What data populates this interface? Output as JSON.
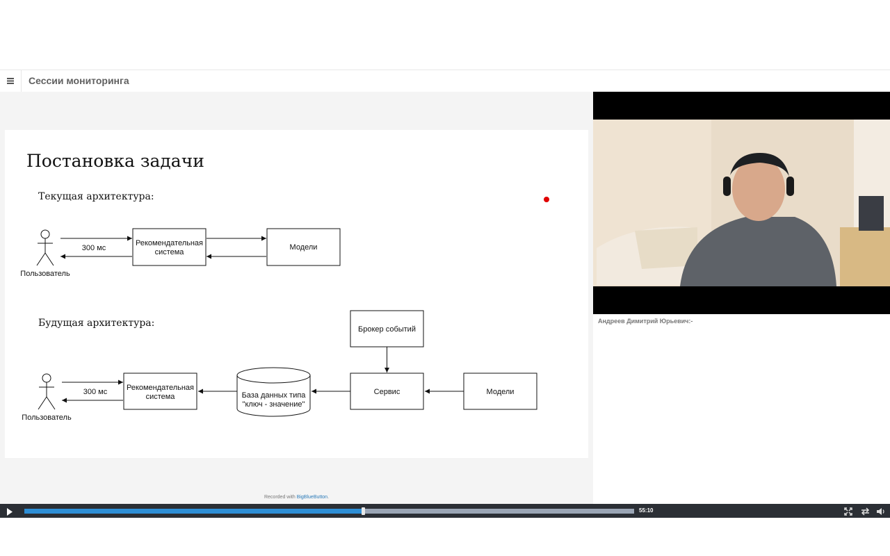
{
  "header": {
    "menu_icon": "hamburger-icon",
    "title": "Сессии мониторинга"
  },
  "slide": {
    "title": "Постановка задачи",
    "current_label": "Текущая архитектура:",
    "future_label": "Будущая архитектура:",
    "current": {
      "user_label": "Пользователь",
      "latency": "300 мс",
      "recsys_line1": "Рекомендательная",
      "recsys_line2": "система",
      "models": "Модели"
    },
    "future": {
      "user_label": "Пользователь",
      "latency": "300 мс",
      "recsys_line1": "Рекомендательная",
      "recsys_line2": "система",
      "db_line1": "База данных типа",
      "db_line2": "\"ключ - значение\"",
      "service": "Сервис",
      "broker": "Брокер событий",
      "models": "Модели"
    },
    "pointer_color": "#e00000"
  },
  "footer": {
    "recorded_prefix": "Recorded with ",
    "recorded_link": "BigBlueButton",
    "recorded_suffix": "."
  },
  "webcam": {
    "caption": "Андреев Димитрий Юрьевич:-"
  },
  "player": {
    "time": "55:10",
    "progress": 0.555,
    "icons": [
      "play-icon",
      "fullscreen-icon",
      "swap-icon",
      "volume-icon"
    ]
  },
  "colors": {
    "progress_fill": "#2e8fd6",
    "progress_track": "#9aa5b5",
    "player_bg": "#2b2f35",
    "link": "#2a7ab8"
  }
}
